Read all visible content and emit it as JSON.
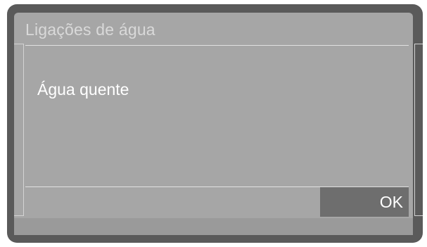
{
  "dialog": {
    "title": "Ligações de água",
    "body_text": "Água quente",
    "ok_label": "OK"
  },
  "colors": {
    "frame": "#5a5a5a",
    "screen": "#a6a6a6",
    "ok_button": "#6e6e6e",
    "text": "#ffffff",
    "title_text": "#d9d9d9"
  }
}
